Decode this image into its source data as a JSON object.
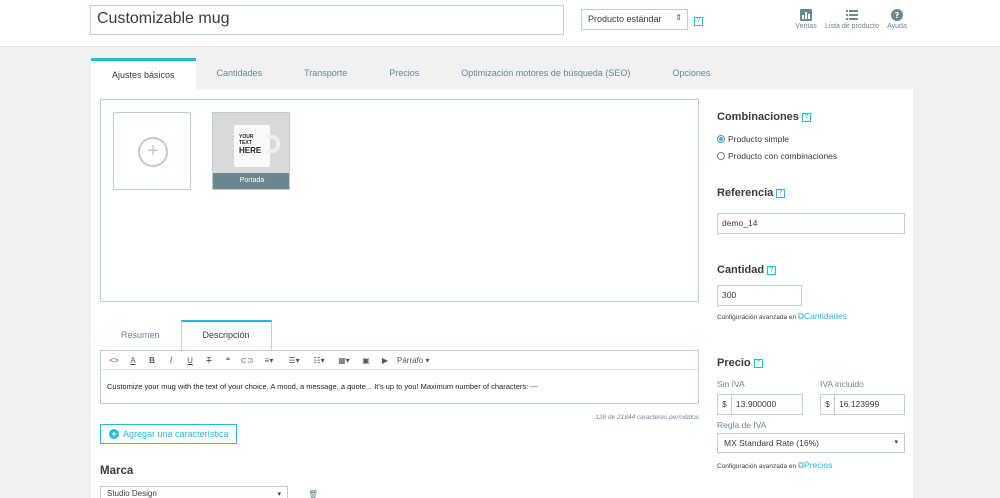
{
  "header": {
    "product_name": "Customizable mug",
    "product_type": "Producto estándar",
    "actions": [
      {
        "label": "Ventas",
        "icon": "bar-chart-icon"
      },
      {
        "label": "Lista de producto",
        "icon": "list-icon"
      },
      {
        "label": "Ayuda",
        "icon": "help-circle-icon"
      }
    ]
  },
  "tabs": [
    "Ajustes básicos",
    "Cantidades",
    "Transporte",
    "Precios",
    "Optimización motores de búsqueda (SEO)",
    "Opciones"
  ],
  "images": {
    "cover_label": "Portada",
    "mug_line1": "YOUR TEXT",
    "mug_line2": "HERE"
  },
  "description": {
    "tabs": [
      "Resumen",
      "Descripción"
    ],
    "paragraph_label": "Párrafo",
    "text": "Customize your mug with the text of your choice. A mood, a message, a quote... It's up to you! Maximum number of characters: ---",
    "counter": "128 de 21844 caracteres permitidos"
  },
  "features": {
    "add_button": "Agregar una característica"
  },
  "brand": {
    "title": "Marca",
    "value": "Studio Design"
  },
  "combinations": {
    "title": "Combinaciones",
    "options": [
      {
        "label": "Producto simple",
        "selected": true
      },
      {
        "label": "Producto con combinaciones",
        "selected": false
      }
    ]
  },
  "reference": {
    "title": "Referencia",
    "value": "demo_14"
  },
  "quantity": {
    "title": "Cantidad",
    "value": "300",
    "hint": "Configuración avanzada en",
    "link": "Cantidades"
  },
  "price": {
    "title": "Precio",
    "excl_label": "Sin IVA",
    "incl_label": "IVA incluido",
    "currency": "$",
    "excl_value": "13.900000",
    "incl_value": "16.123999",
    "tax_rule_label": "Regla de IVA",
    "tax_rule_value": "MX Standard Rate (16%)",
    "hint": "Configuración avanzada en",
    "link": "Precios"
  },
  "colors": {
    "accent": "#25b9d7",
    "border": "#bbcdd2",
    "muted": "#6c868e"
  }
}
